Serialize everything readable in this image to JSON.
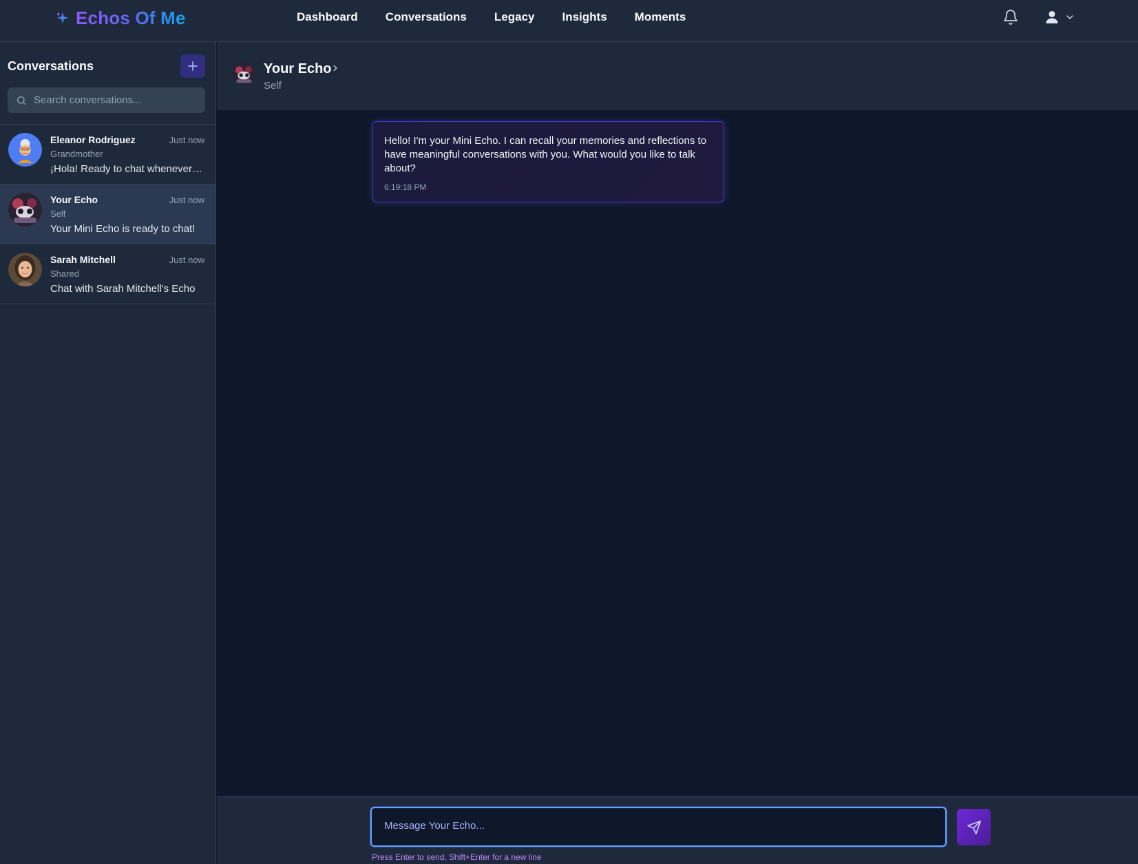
{
  "app": {
    "brand_name": "Echos Of Me",
    "brand_icon": "sparkle-icon"
  },
  "nav": {
    "items": [
      {
        "label": "Dashboard"
      },
      {
        "label": "Conversations"
      },
      {
        "label": "Legacy"
      },
      {
        "label": "Insights"
      },
      {
        "label": "Moments"
      }
    ]
  },
  "header_icons": {
    "notifications": "bell-icon",
    "user": "user-icon",
    "user_menu": "chevron-down-icon"
  },
  "sidebar": {
    "title": "Conversations",
    "add_icon": "plus-icon",
    "search_placeholder": "Search conversations...",
    "conversations": [
      {
        "name": "Eleanor Rodriguez",
        "role": "Grandmother",
        "time": "Just now",
        "preview": "¡Hola! Ready to chat whenever you are!",
        "active": false
      },
      {
        "name": "Your Echo",
        "role": "Self",
        "time": "Just now",
        "preview": "Your Mini Echo is ready to chat!",
        "active": true
      },
      {
        "name": "Sarah Mitchell",
        "role": "Shared",
        "time": "Just now",
        "preview": "Chat with Sarah Mitchell's Echo",
        "active": false
      }
    ]
  },
  "chat": {
    "name": "Your Echo",
    "role": "Self",
    "messages": [
      {
        "text": "Hello! I'm your Mini Echo. I can recall your memories and reflections to have meaningful conversations with you. What would you like to talk about?",
        "time": "6:19:18 PM"
      }
    ]
  },
  "composer": {
    "placeholder": "Message Your Echo...",
    "hint": "Press Enter to send, Shift+Enter for a new line",
    "send_icon": "send-icon"
  },
  "colors": {
    "background": "#0f172a",
    "panel": "#1e293b",
    "accent": "#6366f1",
    "accent_purple": "#8b5cf6",
    "accent_blue": "#0ea5e9"
  }
}
